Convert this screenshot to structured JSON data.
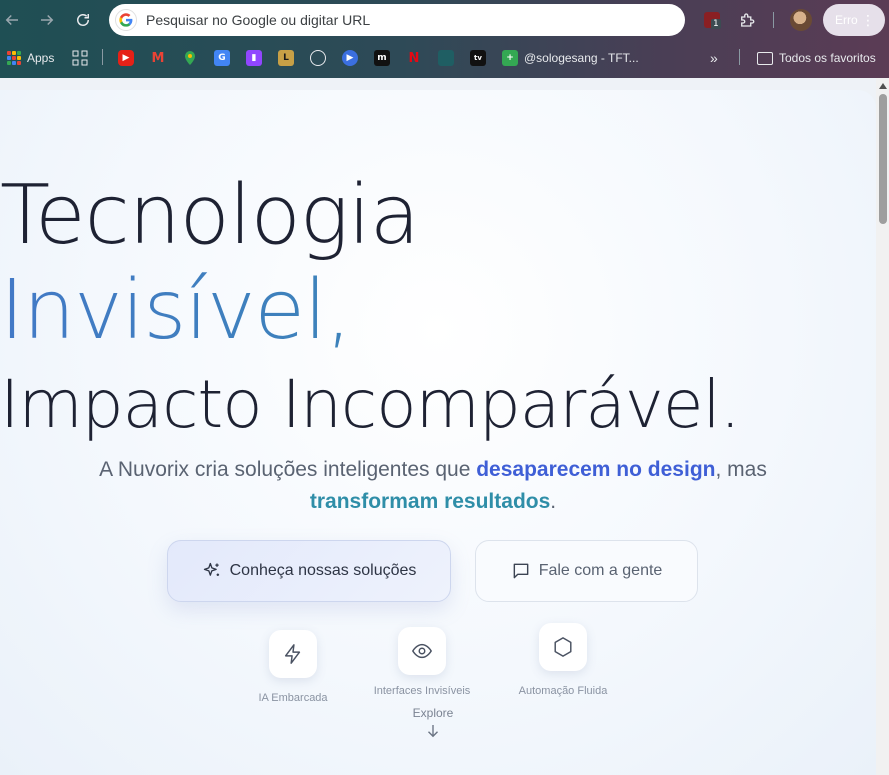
{
  "browser": {
    "omnibox_placeholder": "Pesquisar no Google ou digitar URL",
    "profile_status": "Erro",
    "extension_badge": "1",
    "bookmarks": {
      "apps_label": "Apps",
      "tft_label": "@sologesang - TFT...",
      "all_favorites_label": "Todos os favoritos",
      "overflow": "»"
    }
  },
  "hero": {
    "title_line1": "Tecnologia",
    "title_line2": "Invisível,",
    "title_line3": "Impacto Incomparável.",
    "subtitle_pre": "A Nuvorix cria soluções inteligentes que ",
    "subtitle_hl1": "desaparecem no design",
    "subtitle_mid": ", mas ",
    "subtitle_hl2": "transformam resultados",
    "subtitle_post": "."
  },
  "cta": {
    "primary_label": "Conheça nossas soluções",
    "secondary_label": "Fale com a gente"
  },
  "features": [
    {
      "label": "IA Embarcada",
      "icon": "lightning-icon"
    },
    {
      "label": "Interfaces Invisíveis",
      "icon": "eye-icon"
    },
    {
      "label": "Automação Fluida",
      "icon": "hexagon-icon"
    }
  ],
  "explore_label": "Explore",
  "colors": {
    "accent_blue": "#3f5fd6",
    "accent_teal": "#2f8ea8",
    "heading": "#1e2233"
  }
}
